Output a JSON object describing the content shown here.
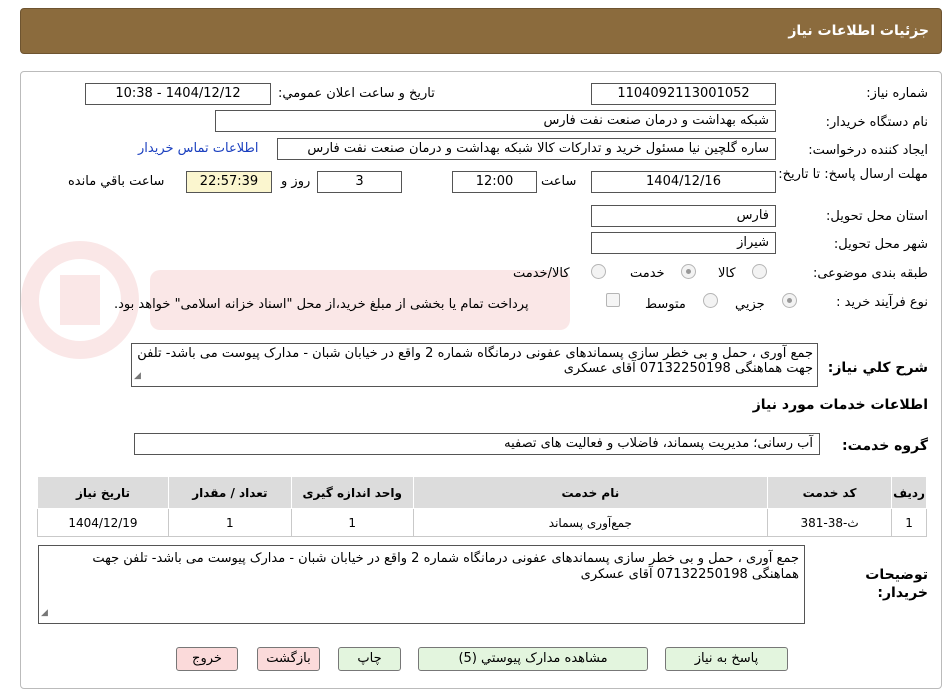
{
  "title": "جزئیات اطلاعات نیاز",
  "fields": {
    "need_number_label": "شماره نیاز:",
    "need_number": "1104092113001052",
    "announce_label": "تاریخ و ساعت اعلان عمومي:",
    "announce_value": "1404/12/12 - 10:38",
    "buyer_org_label": "نام دستگاه خريدار:",
    "buyer_org": "شبکه بهداشت و درمان صنعت نفت فارس",
    "creator_label": "ايجاد کننده درخواست:",
    "creator": "ساره گلچین نیا مسئول خرید و تدارکات کالا شبکه بهداشت و درمان صنعت نفت فارس",
    "contact_link": "اطلاعات تماس خريدار",
    "deadline_label": "مهلت ارسال پاسخ: تا تاریخ:",
    "deadline_date": "1404/12/16",
    "time_label": "ساعت",
    "deadline_time": "12:00",
    "days": "3",
    "days_label": "روز و",
    "remaining": "22:57:39",
    "remaining_label": "ساعت باقي مانده",
    "province_label": "استان محل تحويل:",
    "province": "فارس",
    "city_label": "شهر محل تحويل:",
    "city": "شیراز",
    "category_label": "طبقه بندی موضوعی:",
    "category_options": [
      "کالا",
      "خدمت",
      "کالا/خدمت"
    ],
    "process_label": "نوع فرآيند خريد :",
    "process_options": [
      "جزيي",
      "متوسط"
    ],
    "payment_note": "پرداخت تمام یا بخشی از مبلغ خرید،از محل \"اسناد خزانه اسلامی\" خواهد بود.",
    "desc_label": "شرح کلي نياز:",
    "desc": "جمع آوری ، حمل و بی خطر سازی پسماندهای عفونی درمانگاه شماره 2 واقع در خیابان شبان - مدارک پیوست می باشد- تلفن جهت هماهنگی 07132250198 آقای عسکری"
  },
  "services_heading": "اطلاعات خدمات مورد نياز",
  "service_group_label": "گروه خدمت:",
  "service_group": "آب رسانی؛ مديريت پسماند، فاضلاب و فعالیت های تصفیه",
  "table": {
    "headers": [
      "رديف",
      "کد خدمت",
      "نام خدمت",
      "واحد اندازه گيری",
      "تعداد / مقدار",
      "تاريخ نياز"
    ],
    "rows": [
      [
        "1",
        "ث-38-381",
        "جمع‌آوری پسماند",
        "1",
        "1",
        "1404/12/19"
      ]
    ]
  },
  "buyer_notes_label": "توضيحات خريدار:",
  "buyer_notes": "جمع آوری ، حمل و بی خطر سازی پسماندهای عفونی درمانگاه شماره 2 واقع در خیابان شبان - مدارک پیوست می باشد- تلفن جهت هماهنگی 07132250198 آقای عسکری",
  "buttons": {
    "reply": "پاسخ به نياز",
    "attachments": "مشاهده مدارک پيوستي (5)",
    "print": "چاپ",
    "back": "بازگشت",
    "exit": "خروج"
  },
  "colors": {
    "header": "#8b6b3d",
    "button": "#e3f5de",
    "button_pink": "#fbdada",
    "remaining_bg": "#fbf6cf",
    "link": "#1a3fbf"
  }
}
